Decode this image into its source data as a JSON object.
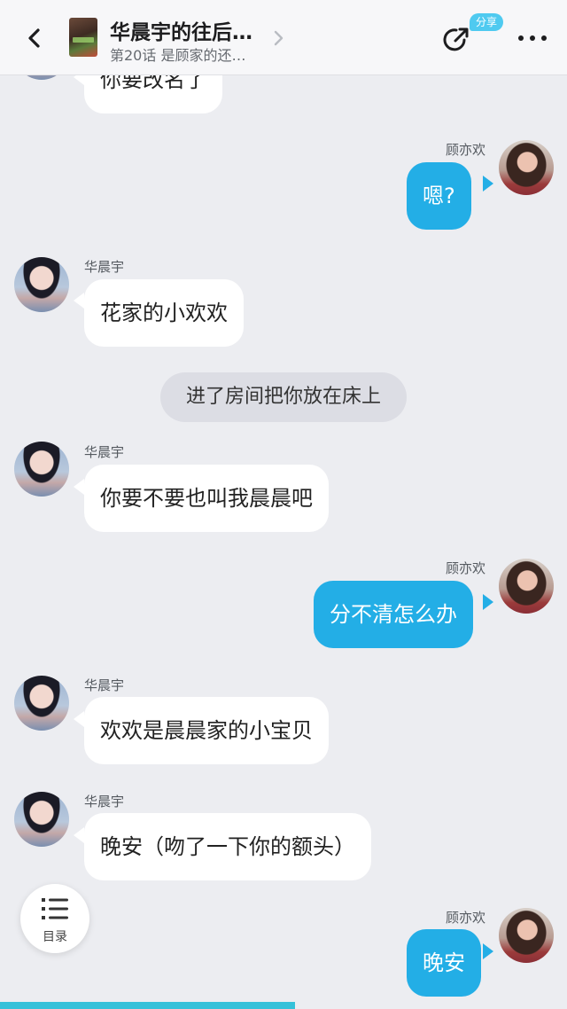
{
  "header": {
    "title": "华晨宇的往后…",
    "subtitle": "第20话 是顾家的还…",
    "share_badge": "分享",
    "icons": [
      "back-icon",
      "chevron-right-icon",
      "share-icon",
      "more-icon"
    ]
  },
  "messages": [
    {
      "side": "left",
      "sender": "",
      "text": "你要改名了",
      "partial": true
    },
    {
      "side": "right",
      "sender": "顾亦欢",
      "text": "嗯?"
    },
    {
      "side": "left",
      "sender": "华晨宇",
      "text": "花家的小欢欢"
    },
    {
      "side": "narration",
      "text": "进了房间把你放在床上"
    },
    {
      "side": "left",
      "sender": "华晨宇",
      "text": "你要不要也叫我晨晨吧"
    },
    {
      "side": "right",
      "sender": "顾亦欢",
      "text": "分不清怎么办"
    },
    {
      "side": "left",
      "sender": "华晨宇",
      "text": "欢欢是晨晨家的小宝贝"
    },
    {
      "side": "left",
      "sender": "华晨宇",
      "text": "晚安（吻了一下你的额头）"
    },
    {
      "side": "right",
      "sender": "顾亦欢",
      "text": "晚安"
    }
  ],
  "catalog": {
    "label": "目录"
  },
  "progress": {
    "fraction": 0.52,
    "color": "#35c1d9"
  },
  "colors": {
    "accent": "#23aee6",
    "background": "#ecedf1",
    "badge": "#4fcaf0"
  }
}
